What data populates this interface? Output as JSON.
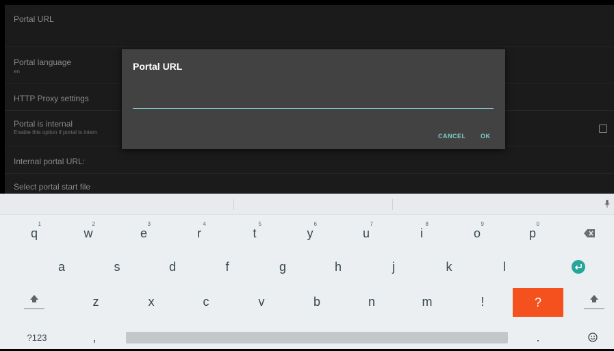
{
  "settings": {
    "rows": [
      {
        "title": "Portal URL",
        "sub": ""
      },
      {
        "title": "Portal language",
        "sub": "en"
      },
      {
        "title": "HTTP Proxy settings",
        "sub": ""
      },
      {
        "title": "Portal is internal",
        "sub": "Enable this option if portal is intern"
      },
      {
        "title": "Internal portal URL:",
        "sub": ""
      },
      {
        "title": "Select portal start file",
        "sub": ""
      }
    ]
  },
  "dialog": {
    "title": "Portal URL",
    "input_value": "",
    "cancel_label": "CANCEL",
    "ok_label": "OK"
  },
  "keyboard": {
    "row1": [
      {
        "key": "q",
        "hint": "1"
      },
      {
        "key": "w",
        "hint": "2"
      },
      {
        "key": "e",
        "hint": "3"
      },
      {
        "key": "r",
        "hint": "4"
      },
      {
        "key": "t",
        "hint": "5"
      },
      {
        "key": "y",
        "hint": "6"
      },
      {
        "key": "u",
        "hint": "7"
      },
      {
        "key": "i",
        "hint": "8"
      },
      {
        "key": "o",
        "hint": "9"
      },
      {
        "key": "p",
        "hint": "0"
      }
    ],
    "row2": [
      "a",
      "s",
      "d",
      "f",
      "g",
      "h",
      "j",
      "k",
      "l"
    ],
    "row3": [
      "z",
      "x",
      "c",
      "v",
      "b",
      "n",
      "m",
      "!",
      "?"
    ],
    "symbols_label": "?123",
    "comma": ",",
    "period": ".",
    "icons": {
      "backspace": "backspace-icon",
      "enter": "enter-icon",
      "shift": "shift-icon",
      "mic": "microphone-icon",
      "emoji": "emoji-icon"
    },
    "colors": {
      "accent": "#f4511e",
      "enter": "#26a69a",
      "dialog_accent": "#80cbc4"
    }
  }
}
